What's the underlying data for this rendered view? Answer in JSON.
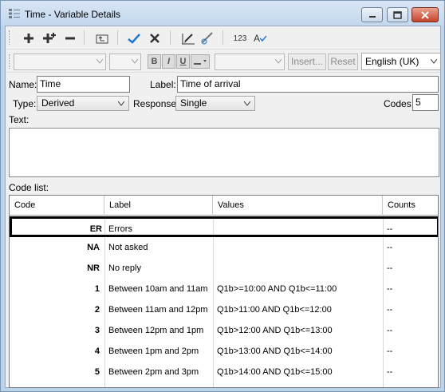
{
  "window": {
    "title": "Time - Variable Details"
  },
  "toolbar": {
    "numbering_label": "123",
    "spellcheck_label": "A"
  },
  "format_bar": {
    "bold": "B",
    "italic": "I",
    "underline": "U",
    "insert_label": "Insert...",
    "reset_label": "Reset",
    "language": "English (UK)"
  },
  "form": {
    "name_label": "Name:",
    "name_value": "Time",
    "label_label": "Label:",
    "label_value": "Time of arrival",
    "type_label": "Type:",
    "type_value": "Derived",
    "response_label": "Response:",
    "response_value": "Single",
    "codes_label": "Codes:",
    "codes_value": "5",
    "text_label": "Text:",
    "codelist_label": "Code list:"
  },
  "code_list": {
    "columns": [
      "Code",
      "Label",
      "Values",
      "Counts"
    ],
    "rows": [
      {
        "code": "ER",
        "label": "Errors",
        "values": "",
        "counts": "--"
      },
      {
        "code": "NA",
        "label": "Not asked",
        "values": "",
        "counts": "--"
      },
      {
        "code": "NR",
        "label": "No reply",
        "values": "",
        "counts": "--"
      },
      {
        "code": "1",
        "label": "Between 10am and 11am",
        "values": "Q1b>=10:00 AND Q1b<=11:00",
        "counts": "--"
      },
      {
        "code": "2",
        "label": "Between 11am and 12pm",
        "values": "Q1b>11:00 AND Q1b<=12:00",
        "counts": "--"
      },
      {
        "code": "3",
        "label": "Between 12pm and 1pm",
        "values": "Q1b>12:00 AND Q1b<=13:00",
        "counts": "--"
      },
      {
        "code": "4",
        "label": "Between 1pm and 2pm",
        "values": "Q1b>13:00 AND Q1b<=14:00",
        "counts": "--"
      },
      {
        "code": "5",
        "label": "Between 2pm and 3pm",
        "values": "Q1b>14:00 AND Q1b<=15:00",
        "counts": "--"
      }
    ]
  },
  "colors": {
    "accent_check": "#1e78d2",
    "titlebar": "#c3d7ee",
    "close_button": "#c5432b"
  }
}
